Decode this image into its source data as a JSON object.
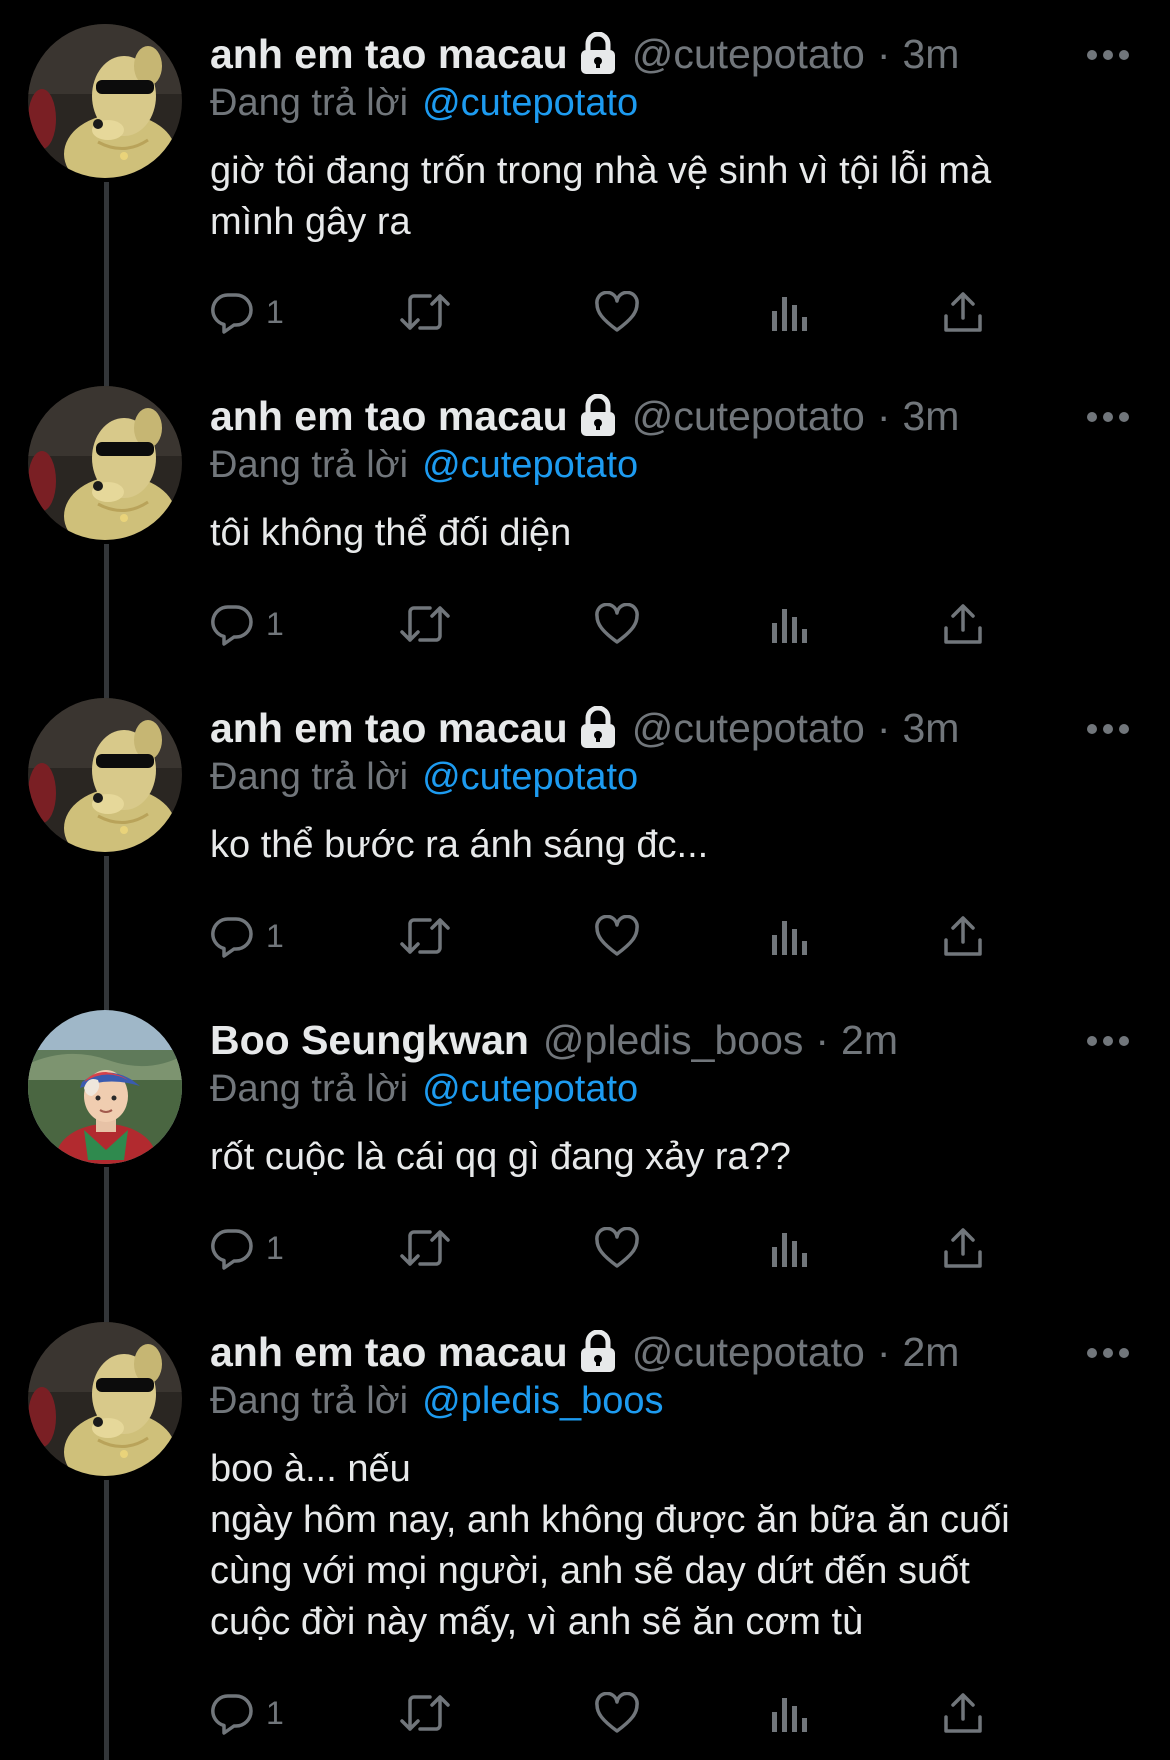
{
  "colors": {
    "background": "#000000",
    "text": "#e7e9ea",
    "secondary": "#71767b",
    "link": "#1d9bf0",
    "thread_line": "#333639"
  },
  "tweets": [
    {
      "display_name": "anh em tao macau",
      "protected": true,
      "avatar": "dog-sunglasses-avatar",
      "handle": "@cutepotato",
      "dot": "·",
      "time": "3m",
      "replying_prefix": "Đang trả lời",
      "replying_to": "@cutepotato",
      "text": "giờ tôi đang trốn trong nhà vệ sinh vì tội lỗi mà\nmình gây ra",
      "reply_count": "1"
    },
    {
      "display_name": "anh em tao macau",
      "protected": true,
      "avatar": "dog-sunglasses-avatar",
      "handle": "@cutepotato",
      "dot": "·",
      "time": "3m",
      "replying_prefix": "Đang trả lời",
      "replying_to": "@cutepotato",
      "text": "tôi không thể đối diện",
      "reply_count": "1"
    },
    {
      "display_name": "anh em tao macau",
      "protected": true,
      "avatar": "dog-sunglasses-avatar",
      "handle": "@cutepotato",
      "dot": "·",
      "time": "3m",
      "replying_prefix": "Đang trả lời",
      "replying_to": "@cutepotato",
      "text": "ko thể bước ra ánh sáng đc...",
      "reply_count": "1"
    },
    {
      "display_name": "Boo Seungkwan",
      "protected": false,
      "avatar": "person-cap-avatar",
      "handle": "@pledis_boos",
      "dot": "·",
      "time": "2m",
      "replying_prefix": "Đang trả lời",
      "replying_to": "@cutepotato",
      "text": "rốt cuộc là cái qq gì đang xảy ra??",
      "reply_count": "1"
    },
    {
      "display_name": "anh em tao macau",
      "protected": true,
      "avatar": "dog-sunglasses-avatar",
      "handle": "@cutepotato",
      "dot": "·",
      "time": "2m",
      "replying_prefix": "Đang trả lời",
      "replying_to": "@pledis_boos",
      "text": "boo à... nếu\nngày hôm nay, anh không được ăn bữa ăn cuối\ncùng với mọi người, anh sẽ day dứt đến suốt\ncuộc đời này mấy, vì anh sẽ ăn cơm tù",
      "reply_count": "1"
    }
  ]
}
